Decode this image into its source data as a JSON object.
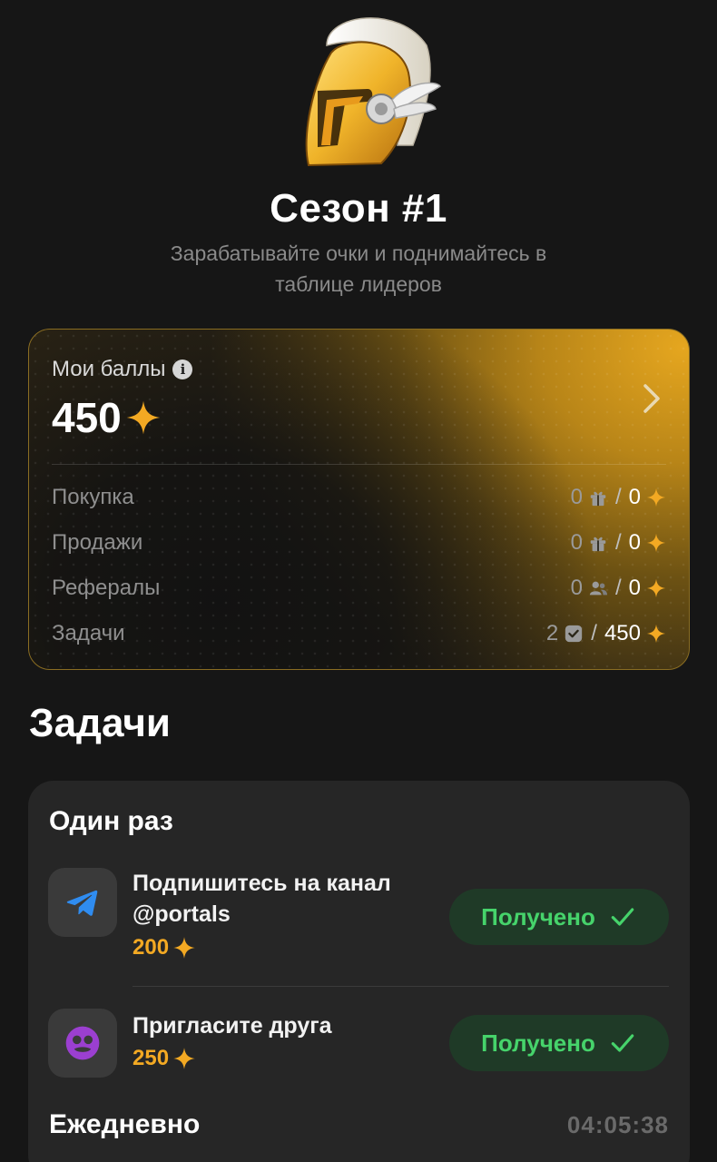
{
  "season": {
    "title": "Сезон #1",
    "subtitle": "Зарабатывайте очки и поднимайтесь в таблице лидеров"
  },
  "points_card": {
    "label": "Мои баллы",
    "total": "450",
    "rows": [
      {
        "label": "Покупка",
        "count": "0",
        "count_icon": "gift-icon",
        "points": "0"
      },
      {
        "label": "Продажи",
        "count": "0",
        "count_icon": "gift-icon",
        "points": "0"
      },
      {
        "label": "Рефералы",
        "count": "0",
        "count_icon": "users-icon",
        "points": "0"
      },
      {
        "label": "Задачи",
        "count": "2",
        "count_icon": "checkbox-icon",
        "points": "450"
      }
    ]
  },
  "tasks": {
    "heading": "Задачи",
    "groups": [
      {
        "title": "Один раз",
        "items": [
          {
            "title": "Подпишитесь на канал @portals",
            "reward": "200",
            "icon": "telegram-icon",
            "status": "Получено"
          },
          {
            "title": "Пригласите друга",
            "reward": "250",
            "icon": "friend-icon",
            "status": "Получено"
          }
        ]
      },
      {
        "title": "Ежедневно",
        "timer": "04:05:38"
      }
    ]
  },
  "colors": {
    "background": "#161616",
    "card": "#262626",
    "accent_gold": "#f3a923",
    "success_green": "#46d36b",
    "success_bg": "#1f3a27"
  }
}
